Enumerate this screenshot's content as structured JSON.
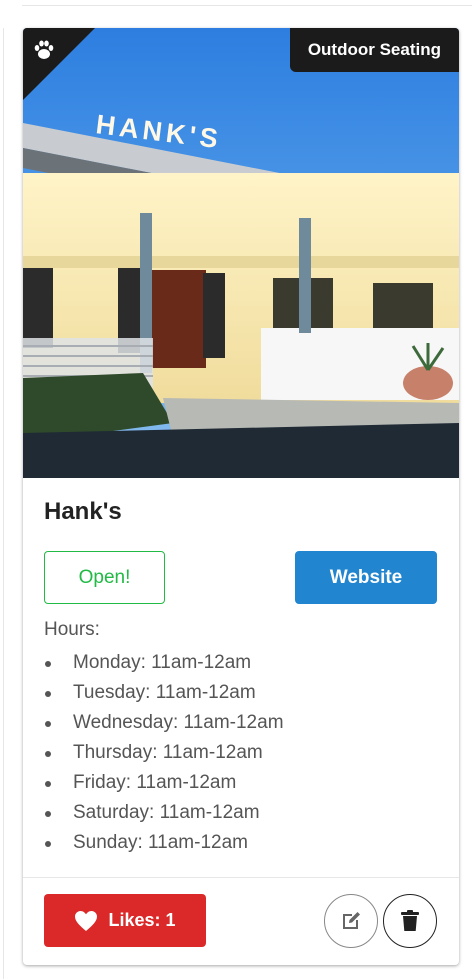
{
  "card": {
    "tag": "Outdoor Seating",
    "corner_icon": "paw-icon",
    "photo_sign": "HANK'S",
    "title": "Hank's",
    "status": "Open!",
    "website_label": "Website",
    "hours_label": "Hours:",
    "hours": [
      "Monday: 11am-12am",
      "Tuesday: 11am-12am",
      "Wednesday: 11am-12am",
      "Thursday: 11am-12am",
      "Friday: 11am-12am",
      "Saturday: 11am-12am",
      "Sunday: 11am-12am"
    ],
    "likes_label": "Likes: 1",
    "likes_icon": "heart-icon",
    "edit_icon": "edit-icon",
    "delete_icon": "trash-icon"
  },
  "colors": {
    "open_green": "#21ba45",
    "website_blue": "#2185d0",
    "likes_red": "#db2828",
    "badge_black": "#1b1b1b"
  }
}
